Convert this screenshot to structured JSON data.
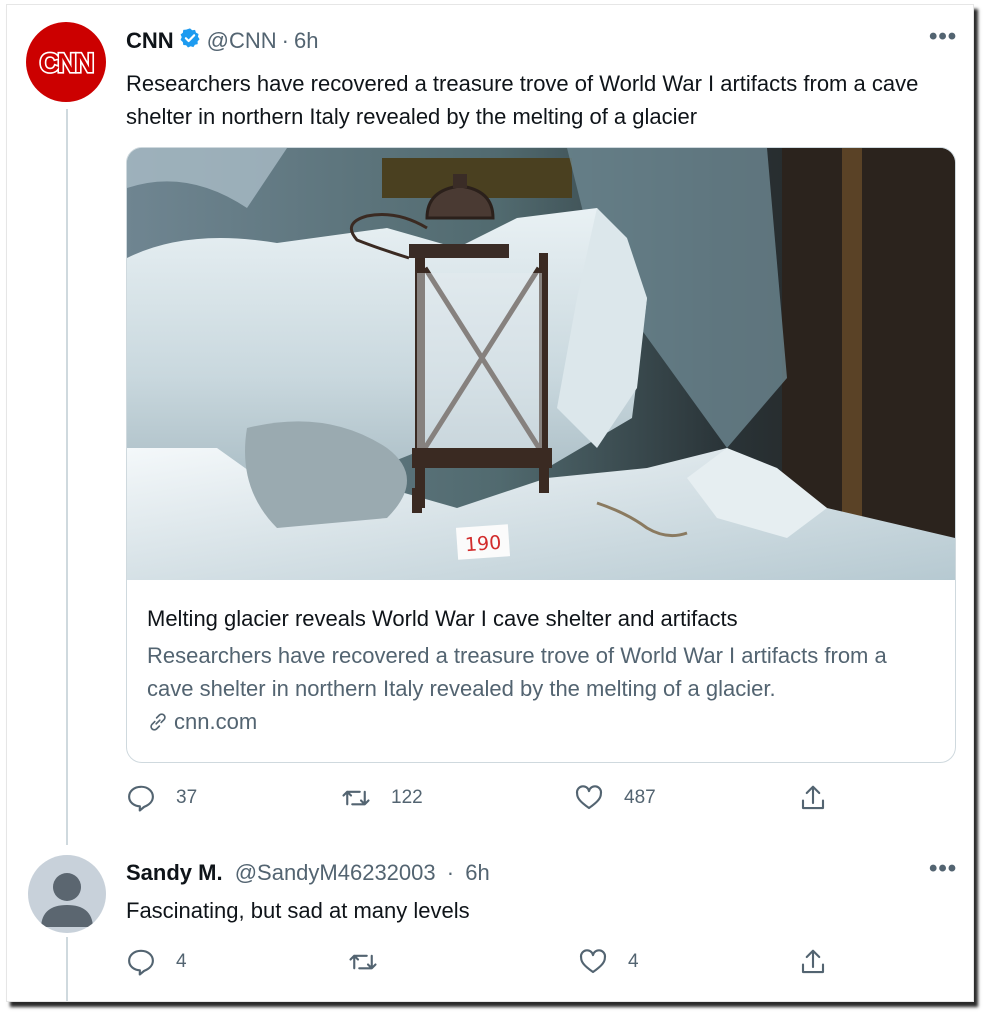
{
  "tweet": {
    "name": "CNN",
    "handle": "@CNN",
    "separator": "·",
    "time": "6h",
    "text": "Researchers have recovered a treasure trove of World War I artifacts from a cave shelter in northern Italy revealed by the melting of a glacier",
    "avatar_logo": "CNN",
    "card": {
      "image_tag": "190",
      "title": "Melting glacier reveals World War I cave shelter and artifacts",
      "description": "Researchers have recovered a treasure trove of World War I artifacts from a cave shelter in northern Italy revealed by the melting of a glacier.",
      "domain": "cnn.com"
    },
    "actions": {
      "replies": "37",
      "retweets": "122",
      "likes": "487"
    }
  },
  "reply": {
    "name": "Sandy M.",
    "handle": "@SandyM46232003",
    "separator": "·",
    "time": "6h",
    "text": "Fascinating, but sad at many levels",
    "actions": {
      "replies": "4",
      "retweets": "",
      "likes": "4"
    }
  },
  "colors": {
    "verified": "#1d9bf0",
    "secondary_text": "#536471",
    "cnn_red": "#cc0000",
    "border": "#cfd9de"
  },
  "icons": [
    "verified-badge-icon",
    "more-icon",
    "reply-icon",
    "retweet-icon",
    "like-icon",
    "share-icon",
    "link-icon",
    "default-avatar-icon"
  ]
}
